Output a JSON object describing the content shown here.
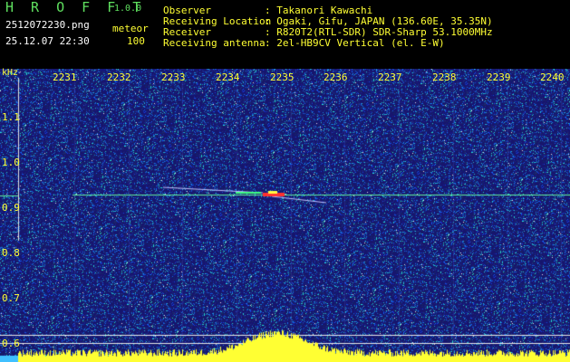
{
  "app": {
    "name": "H R O F F T",
    "version": "1.0.0"
  },
  "file": {
    "name": "2512072230.png",
    "datetime": "25.12.07 22:30"
  },
  "detector": {
    "label": "meteor",
    "count": "100"
  },
  "info": [
    {
      "label": "Observer",
      "value": ": Takanori Kawachi"
    },
    {
      "label": "Receiving Location",
      "value": ": Ogaki, Gifu, JAPAN (136.60E, 35.35N)"
    },
    {
      "label": "Receiver",
      "value": ": R820T2(RTL-SDR) SDR-Sharp 53.1000MHz"
    },
    {
      "label": "Receiving antenna",
      "value": ": 2el-HB9CV Vertical (el. E-W)"
    }
  ],
  "axes": {
    "y_unit": "kHz",
    "x_ticks": [
      "2231",
      "2232",
      "2233",
      "2234",
      "2235",
      "2236",
      "2237",
      "2238",
      "2239",
      "2240"
    ],
    "y_ticks": [
      "1.1",
      "1.0",
      "0.9",
      "0.8",
      "0.7",
      "0.6"
    ]
  },
  "colors": {
    "background": "#000000",
    "spectrogram_bg": "#17156e",
    "accent_green": "#5fe05f",
    "tick_yellow": "#ffff33",
    "carrier_line": "#5ff0a0"
  }
}
